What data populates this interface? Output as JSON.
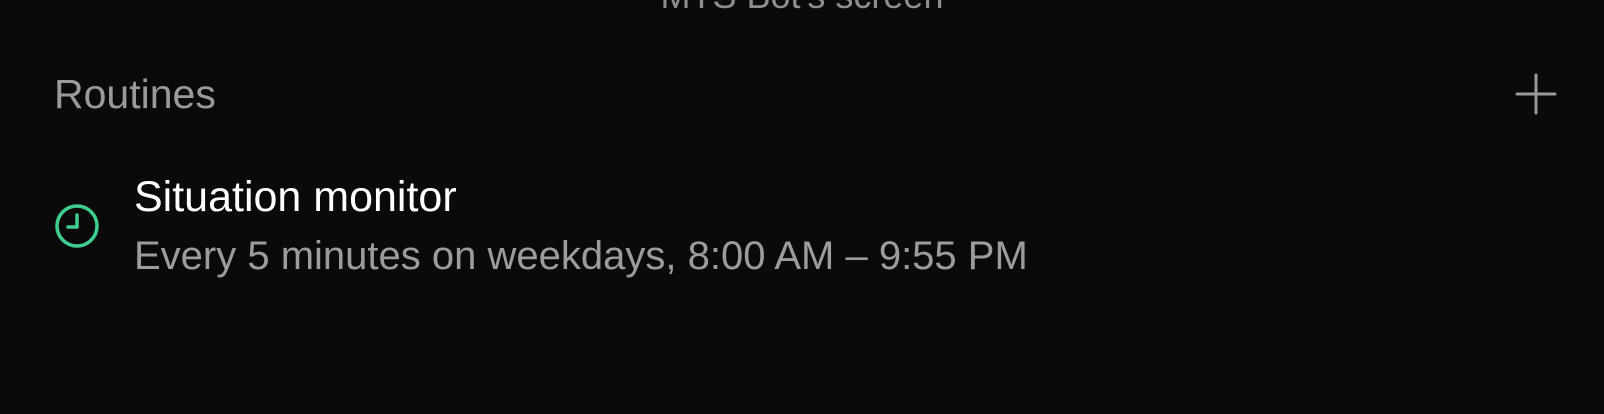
{
  "top_caption": "MTS Bot's screen",
  "routines": {
    "title": "Routines",
    "add_icon": "plus-icon",
    "items": [
      {
        "icon": "clock-icon",
        "icon_color": "#3ecf8e",
        "title": "Situation monitor",
        "schedule": "Every 5 minutes on weekdays, 8:00 AM – 9:55 PM"
      }
    ]
  },
  "colors": {
    "background": "#0a0a0a",
    "muted_text": "#9a9a9a",
    "primary_text": "#ffffff",
    "accent": "#3ecf8e"
  }
}
